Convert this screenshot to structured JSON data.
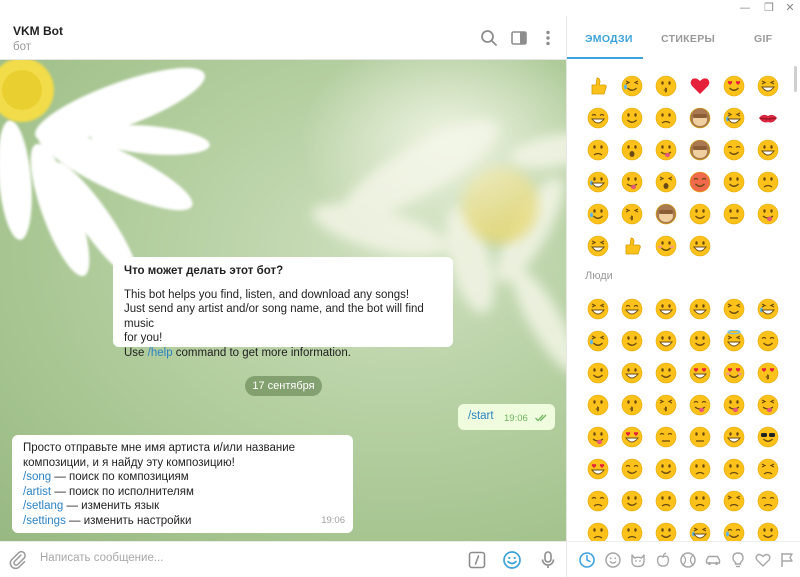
{
  "window": {
    "minimize_glyph": "—",
    "restore_glyph": "❐",
    "close_glyph": "✕"
  },
  "header": {
    "title": "VKM Bot",
    "subtitle": "бот",
    "icons": [
      "search-icon",
      "sidebar-toggle-icon",
      "more-vertical-icon"
    ]
  },
  "info_card": {
    "title": "Что может делать этот бот?",
    "line1": "This bot helps you find, listen, and download any songs!",
    "line2": "Just send any artist and/or song name, and the bot will find music",
    "line3": "for you!",
    "line4_pre": "Use ",
    "line4_link": "/help",
    "line4_post": " command to get more information."
  },
  "date_separator": "17 сентября",
  "outgoing": {
    "text": "/start",
    "time": "19:06"
  },
  "incoming": {
    "line1": "Просто отправьте мне имя артиста и/или название",
    "line2": "композиции, и я найду эту композицию!",
    "commands": [
      {
        "cmd": "/song",
        "desc": " — поиск по композициям"
      },
      {
        "cmd": "/artist",
        "desc": " — поиск по исполнителям"
      },
      {
        "cmd": "/setlang",
        "desc": " — изменить язык"
      },
      {
        "cmd": "/settings",
        "desc": " — изменить настройки"
      }
    ],
    "time": "19:06"
  },
  "composer": {
    "placeholder": "Написать сообщение...",
    "icons": [
      "attach-icon",
      "bot-command-icon",
      "emoji-toggle-icon",
      "microphone-icon"
    ]
  },
  "emoji_panel": {
    "tabs": [
      "ЭМОДЗИ",
      "СТИКЕРЫ",
      "GIF"
    ],
    "active_tab": "ЭМОДЗИ",
    "section_people": "Люди",
    "recent": [
      "thumbs-up",
      "tears-of-joy",
      "blowing-kiss",
      "red-heart",
      "heart-eyes",
      "smiling",
      "grinning",
      "relieved",
      "unamused",
      "see-no-evil",
      "crying",
      "kiss-mark",
      "pensive",
      "flushed",
      "winking-tongue",
      "see-no-evil-monkey",
      "winking",
      "grin",
      "crying",
      "stuck-out-tongue",
      "screaming",
      "pouting",
      "relieved",
      "disappointed",
      "sweat-smile",
      "kissing",
      "hear-no-evil-monkey",
      "smirk",
      "neutral",
      "yum",
      "grin-squint",
      "ok-hand",
      "blush",
      "slight-smile"
    ],
    "people": [
      "grinning",
      "grinning-big",
      "grin",
      "beaming",
      "squinting",
      "sweat-smile",
      "joy",
      "rofl",
      "smiling",
      "smiling-eyes",
      "halo",
      "slight-smile",
      "upside-down",
      "wink",
      "relieved",
      "heart-eyes",
      "smiling-hearts",
      "kissing-heart",
      "kissing",
      "kissing-smiling",
      "kissing-closed",
      "yum",
      "tongue-wink",
      "tongue-squint",
      "zany",
      "starstruck",
      "raised-eyebrow",
      "monocle",
      "nerd",
      "sunglasses",
      "star-eyes",
      "party",
      "smirk",
      "unamused",
      "disappointed",
      "pensive",
      "worried",
      "confused",
      "slight-frown",
      "frown",
      "persevere",
      "confounded",
      "tired",
      "weary",
      "pleading",
      "cry",
      "sob",
      "steam"
    ],
    "category_icons": [
      "recent-clock-icon",
      "smiley-icon",
      "cat-icon",
      "apple-icon",
      "ball-icon",
      "car-icon",
      "lightbulb-icon",
      "heart-symbol-icon",
      "flag-icon"
    ],
    "accent": "#3da3dd"
  },
  "colors": {
    "link": "#2c83c5",
    "outgoing_bg": "#effdde",
    "outgoing_time": "#6fb362",
    "accent": "#3da3dd",
    "emoji_yellow": "#fcc21b"
  }
}
